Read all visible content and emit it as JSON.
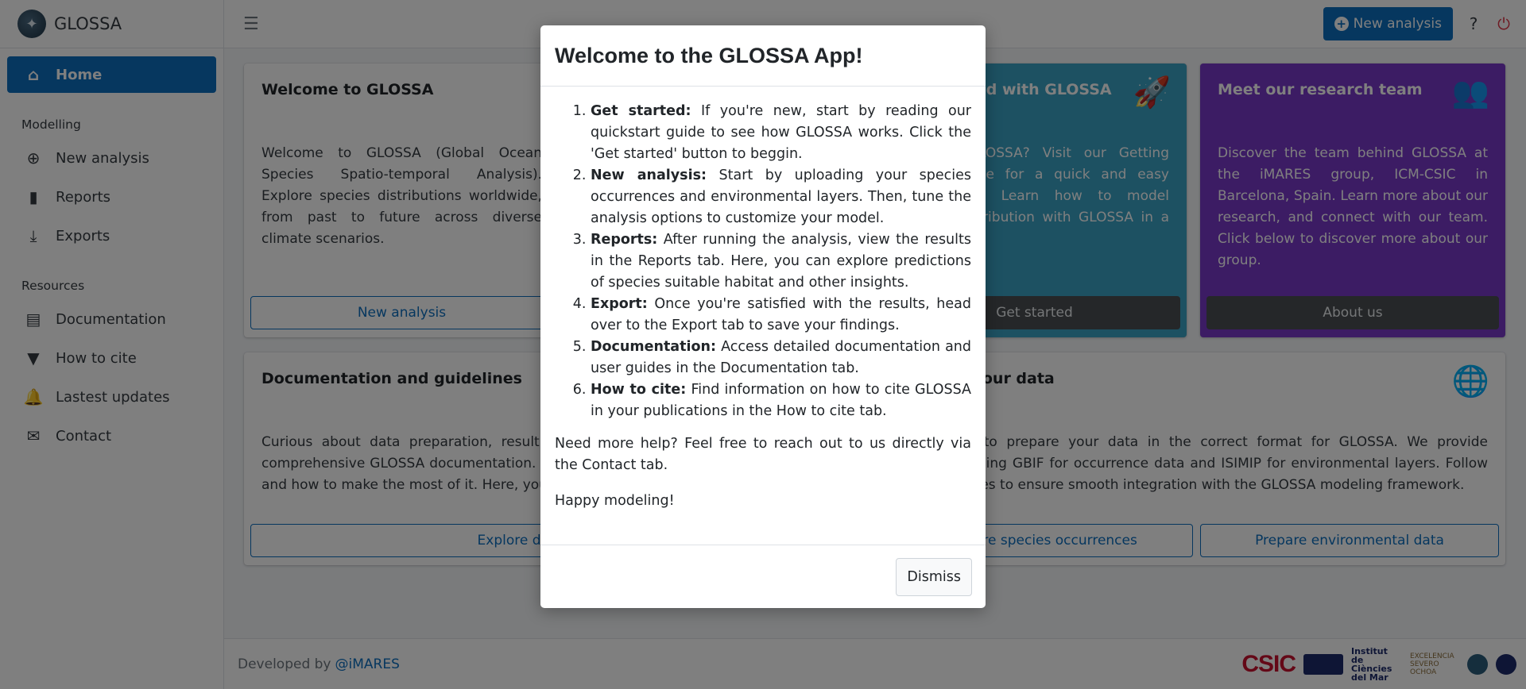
{
  "brand": {
    "name": "GLOSSA",
    "logo_icon": "globe-logo"
  },
  "sidebar": {
    "home": {
      "label": "Home",
      "icon": "home-icon"
    },
    "sections": [
      {
        "header": "Modelling",
        "items": [
          {
            "label": "New analysis",
            "icon": "plus-circle-icon"
          },
          {
            "label": "Reports",
            "icon": "bar-chart-icon"
          },
          {
            "label": "Exports",
            "icon": "download-icon"
          }
        ]
      },
      {
        "header": "Resources",
        "items": [
          {
            "label": "Documentation",
            "icon": "book-icon"
          },
          {
            "label": "How to cite",
            "icon": "bookmark-icon"
          },
          {
            "label": "Lastest updates",
            "icon": "bell-icon"
          },
          {
            "label": "Contact",
            "icon": "envelope-icon"
          }
        ]
      }
    ]
  },
  "topbar": {
    "new_analysis_label": "New analysis",
    "help_label": "?"
  },
  "cards": {
    "welcome": {
      "title": "Welcome to GLOSSA",
      "body": "Welcome to GLOSSA (Global Ocean Species Spatio-temporal Analysis). Explore species distributions worldwide, from past to future across diverse climate scenarios.",
      "button": "New analysis"
    },
    "started": {
      "title": "Get started with GLOSSA",
      "body": "New to GLOSSA? Visit our Getting Started page for a quick and easy introduction. Learn how to model species distribution with GLOSSA in a few steps!",
      "button": "Get started"
    },
    "team": {
      "title": "Meet our research team",
      "body": "Discover the team behind GLOSSA at the iMARES group, ICM-CSIC in Barcelona, Spain. Learn more about our research, and connect with our team. Click below to discover more about our group.",
      "button": "About us"
    },
    "docs": {
      "title": "Documentation and guidelines",
      "body": "Curious about data preparation, result exploration, or model fitting? Explore our comprehensive GLOSSA documentation. Discover all you need to know about GLOSSA and how to make the most of it. Here, you'll find the most up-to-date information.",
      "button": "Explore documentation"
    },
    "data": {
      "title": "Prepare your data",
      "body": "Learn how to prepare your data in the correct format for GLOSSA. We provide examples using GBIF for occurrence data and ISIMIP for environmental layers. Follow our guidelines to ensure smooth integration with the GLOSSA modeling framework.",
      "button_occ": "Prepare species occurrences",
      "button_env": "Prepare environmental data"
    }
  },
  "footer": {
    "developed_by": "Developed by",
    "link": "@iMARES",
    "logos": [
      "CSIC",
      "Institut de Ciències del Mar",
      "EXCELENCIA SEVERO OCHOA"
    ]
  },
  "modal": {
    "title": "Welcome to the GLOSSA App!",
    "steps": [
      {
        "term": "Get started:",
        "text": " If you're new, start by reading our quickstart guide to see how GLOSSA works. Click the 'Get started' button to beggin."
      },
      {
        "term": "New analysis:",
        "text": " Start by uploading your species occurrences and environmental layers. Then, tune the analysis options to customize your model."
      },
      {
        "term": "Reports:",
        "text": " After running the analysis, view the results in the Reports tab. Here, you can explore predictions of species suitable habitat and other insights."
      },
      {
        "term": "Export:",
        "text": " Once you're satisfied with the results, head over to the Export tab to save your findings."
      },
      {
        "term": "Documentation:",
        "text": " Access detailed documentation and user guides in the Documentation tab."
      },
      {
        "term": "How to cite:",
        "text": " Find information on how to cite GLOSSA in your publications in the How to cite tab."
      }
    ],
    "help_text": "Need more help? Feel free to reach out to us directly via the Contact tab.",
    "closing": "Happy modeling!",
    "dismiss": "Dismiss"
  }
}
